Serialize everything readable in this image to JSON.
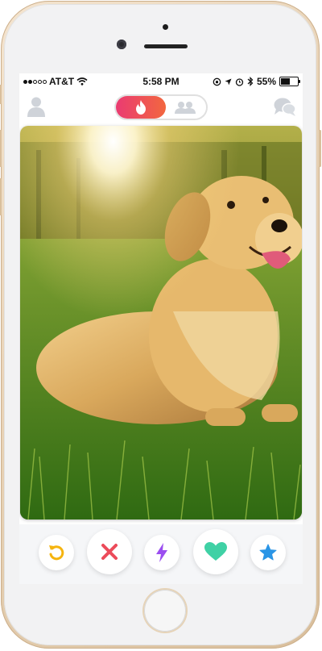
{
  "status_bar": {
    "carrier": "AT&T",
    "time": "5:58 PM",
    "battery_percent": "55%",
    "battery_level": 0.55,
    "signal_bars_filled": 2,
    "signal_bars_total": 5
  },
  "top_nav": {
    "left_icon": "profile-icon",
    "right_icon": "chat-bubbles-icon",
    "toggle": {
      "active": "flame-icon",
      "inactive": "group-icon"
    }
  },
  "card": {
    "photo": "golden retriever lying in sunlit grass"
  },
  "actions": [
    {
      "name": "rewind-button",
      "icon": "rewind-icon",
      "color": "#f5b40f"
    },
    {
      "name": "nope-button",
      "icon": "x-icon",
      "color": "#ec4b5a"
    },
    {
      "name": "boost-button",
      "icon": "lightning-icon",
      "color": "#9b4ef0"
    },
    {
      "name": "like-button",
      "icon": "heart-icon",
      "color": "#3fd1a5"
    },
    {
      "name": "super-like-button",
      "icon": "star-icon",
      "color": "#2a95e6"
    }
  ],
  "colors": {
    "brand_gradient_start": "#ea3b72",
    "brand_gradient_end": "#f2673f",
    "inactive_icon": "#cfd3d9"
  }
}
